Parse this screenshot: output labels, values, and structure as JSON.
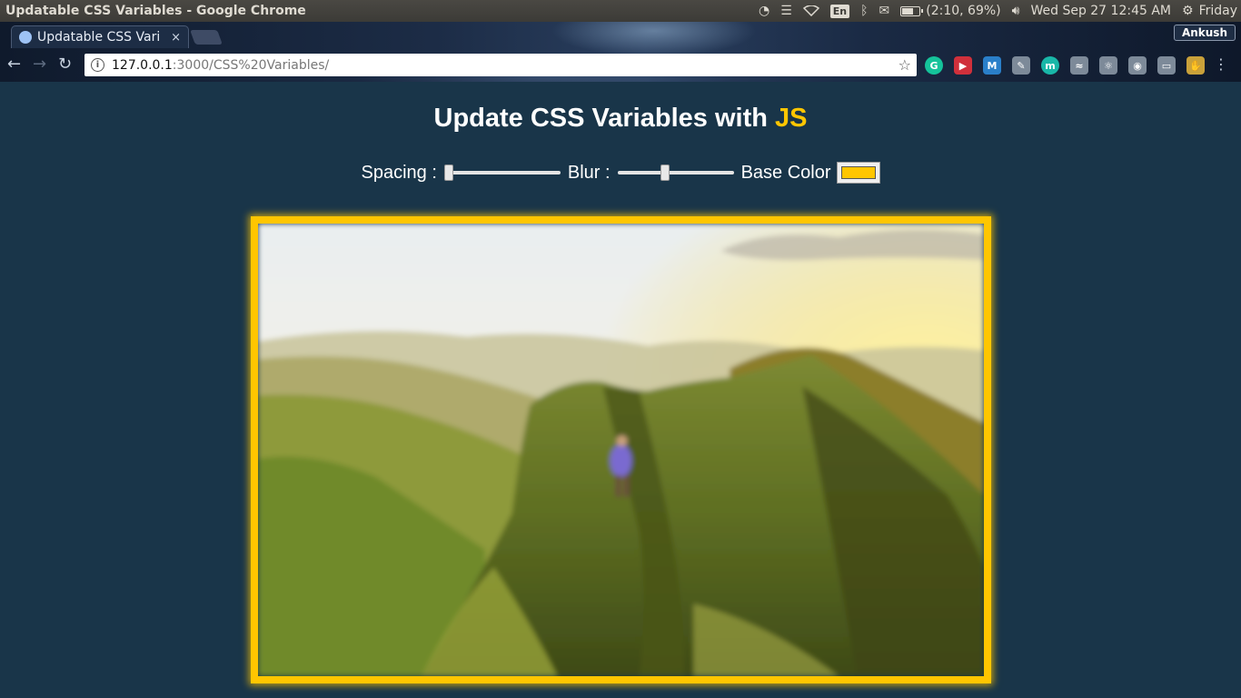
{
  "os_panel": {
    "window_title": "Updatable CSS Variables - Google Chrome",
    "keyboard_layout": "En",
    "battery_text": "(2:10, 69%)",
    "battery_level": 0.69,
    "datetime": "Wed Sep 27 12:45 AM",
    "day_label": "Friday"
  },
  "browser": {
    "tab_title": "Updatable CSS Vari",
    "tab_close": "×",
    "profile_name": "Ankush",
    "url_host": "127.0.0.1",
    "url_path": ":3000/CSS%20Variables/",
    "extensions": [
      {
        "icon": "grammarly-icon",
        "glyph": "G",
        "color": "#15c39a"
      },
      {
        "icon": "pocket-icon",
        "glyph": "▶",
        "color": "#d0303b"
      },
      {
        "icon": "m-icon",
        "glyph": "M",
        "color": "#2a7fc9"
      },
      {
        "icon": "evernote-icon",
        "glyph": "✎",
        "color": "#7d8a99"
      },
      {
        "icon": "mercury-icon",
        "glyph": "m",
        "color": "#19b7a8"
      },
      {
        "icon": "wave-icon",
        "glyph": "≈",
        "color": "#7d8a99"
      },
      {
        "icon": "react-icon",
        "glyph": "⚛",
        "color": "#7d8a99"
      },
      {
        "icon": "camera-icon",
        "glyph": "◉",
        "color": "#7d8a99"
      },
      {
        "icon": "window-icon",
        "glyph": "▭",
        "color": "#7d8a99"
      },
      {
        "icon": "hand-icon",
        "glyph": "✋",
        "color": "#c9a13a"
      }
    ]
  },
  "page": {
    "heading_text": "Update CSS Variables with ",
    "heading_highlight": "JS",
    "accent_color": "#ffc600",
    "background_color": "#193549",
    "controls": {
      "spacing_label": "Spacing :",
      "spacing_value": 10,
      "spacing_min": 10,
      "spacing_max": 200,
      "blur_label": "Blur :",
      "blur_value": 10,
      "blur_min": 0,
      "blur_max": 25,
      "base_color_label": "Base Color",
      "base_color_value": "#ffc600"
    }
  }
}
